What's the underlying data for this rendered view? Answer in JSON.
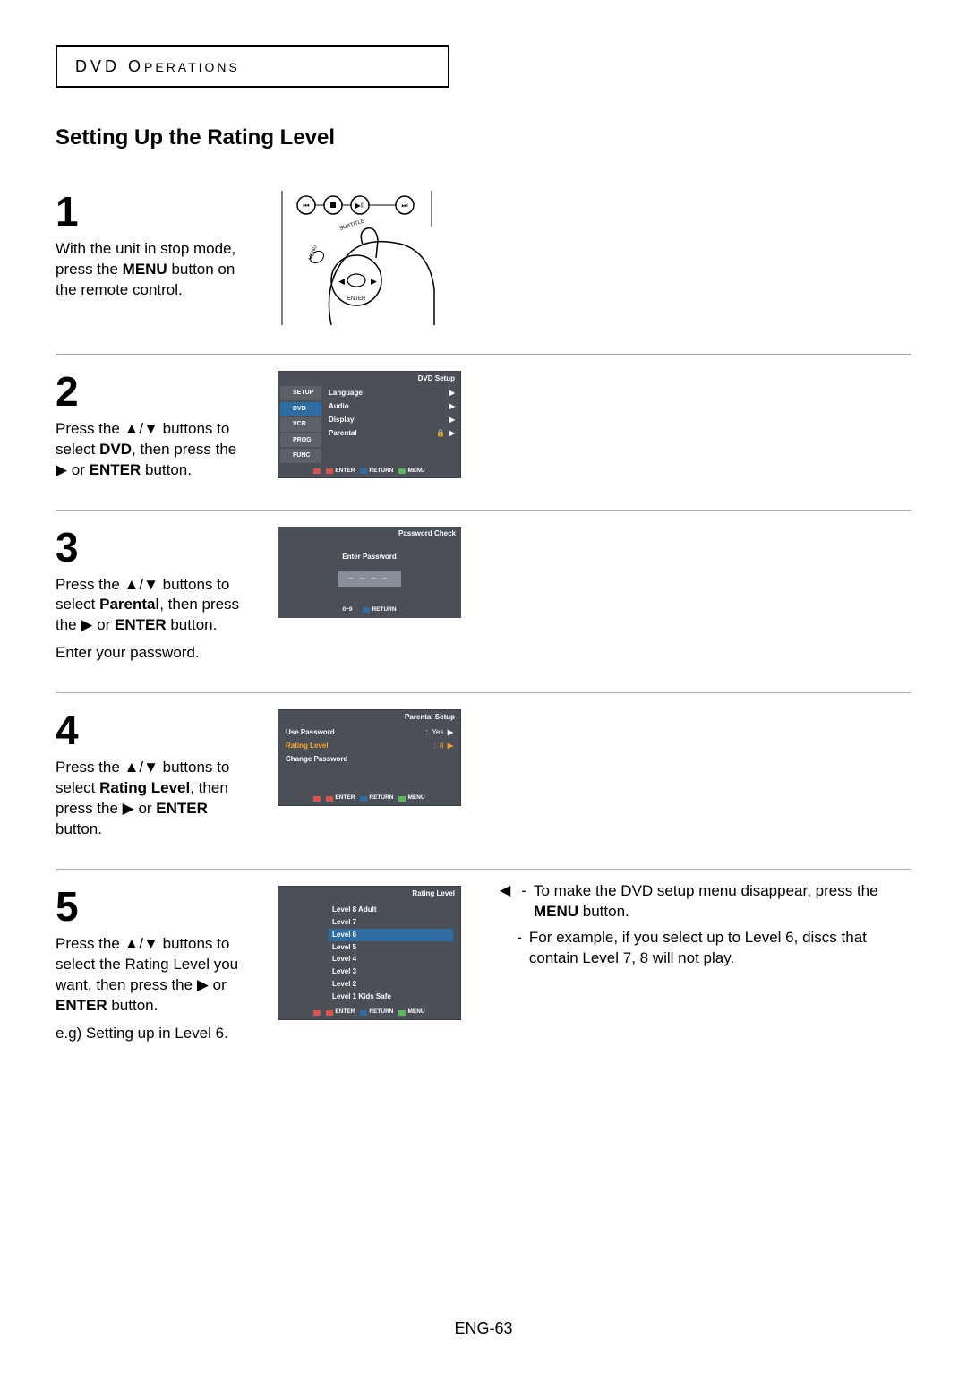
{
  "header": {
    "category": "DVD O",
    "category_suffix": "PERATIONS"
  },
  "title": "Setting Up the Rating Level",
  "steps": {
    "s1": {
      "num": "1",
      "text_a": "With the unit in stop mode, press the ",
      "bold_a": "MENU",
      "text_b": " button on the remote control."
    },
    "s2": {
      "num": "2",
      "text_a": "Press the ▲/▼ buttons to select ",
      "bold_a": "DVD",
      "text_b": ", then press the ▶ or ",
      "bold_b": "ENTER",
      "text_c": " button."
    },
    "s3": {
      "num": "3",
      "text_a": "Press the ▲/▼ buttons to select ",
      "bold_a": "Parental",
      "text_b": ", then press the ▶ or ",
      "bold_b": "ENTER",
      "text_c": " button.",
      "extra": "Enter your password."
    },
    "s4": {
      "num": "4",
      "text_a": "Press the ▲/▼ buttons to select ",
      "bold_a": "Rating Level",
      "text_b": ", then press the ▶ or ",
      "bold_b": "ENTER",
      "text_c": " button."
    },
    "s5": {
      "num": "5",
      "text_a": "Press the ▲/▼ buttons to select the Rating Level you want, then press the ▶ or ",
      "bold_a": "ENTER",
      "text_b": " button.",
      "extra": "e.g) Setting up in Level 6."
    }
  },
  "screens": {
    "dvd_setup": {
      "title": "DVD Setup",
      "side": [
        "SETUP",
        "DVD",
        "VCR",
        "PROG",
        "FUNC"
      ],
      "rows": [
        {
          "label": "Language",
          "lock": false
        },
        {
          "label": "Audio",
          "lock": false
        },
        {
          "label": "Display",
          "lock": false
        },
        {
          "label": "Parental",
          "lock": true
        }
      ],
      "footer": [
        "ENTER",
        "RETURN",
        "MENU"
      ]
    },
    "password": {
      "title": "Password Check",
      "prompt": "Enter Password",
      "mask": "– – – –",
      "footer_left": "0~9",
      "footer_right": "RETURN"
    },
    "parental": {
      "title": "Parental Setup",
      "rows": [
        {
          "label": "Use Password",
          "val": "Yes",
          "hl": false
        },
        {
          "label": "Rating Level",
          "val": "8",
          "hl": true
        },
        {
          "label": "Change Password",
          "val": "",
          "hl": false
        }
      ],
      "footer": [
        "ENTER",
        "RETURN",
        "MENU"
      ]
    },
    "rating": {
      "title": "Rating Level",
      "levels": [
        "Level  8  Adult",
        "Level  7",
        "Level  6",
        "Level  5",
        "Level  4",
        "Level  3",
        "Level  2",
        "Level  1  Kids Safe"
      ],
      "selected_index": 2,
      "footer": [
        "ENTER",
        "RETURN",
        "MENU"
      ]
    }
  },
  "notes": {
    "n1_a": "To make the DVD setup menu disappear, press the ",
    "n1_bold": "MENU",
    "n1_b": " button.",
    "n2": "For example, if you select up to Level 6, discs that contain Level 7, 8 will not play."
  },
  "remote_labels": {
    "subtitle": "SUBTITLE",
    "menu": "MENU",
    "enter": "ENTER"
  },
  "page_number": "ENG-63"
}
